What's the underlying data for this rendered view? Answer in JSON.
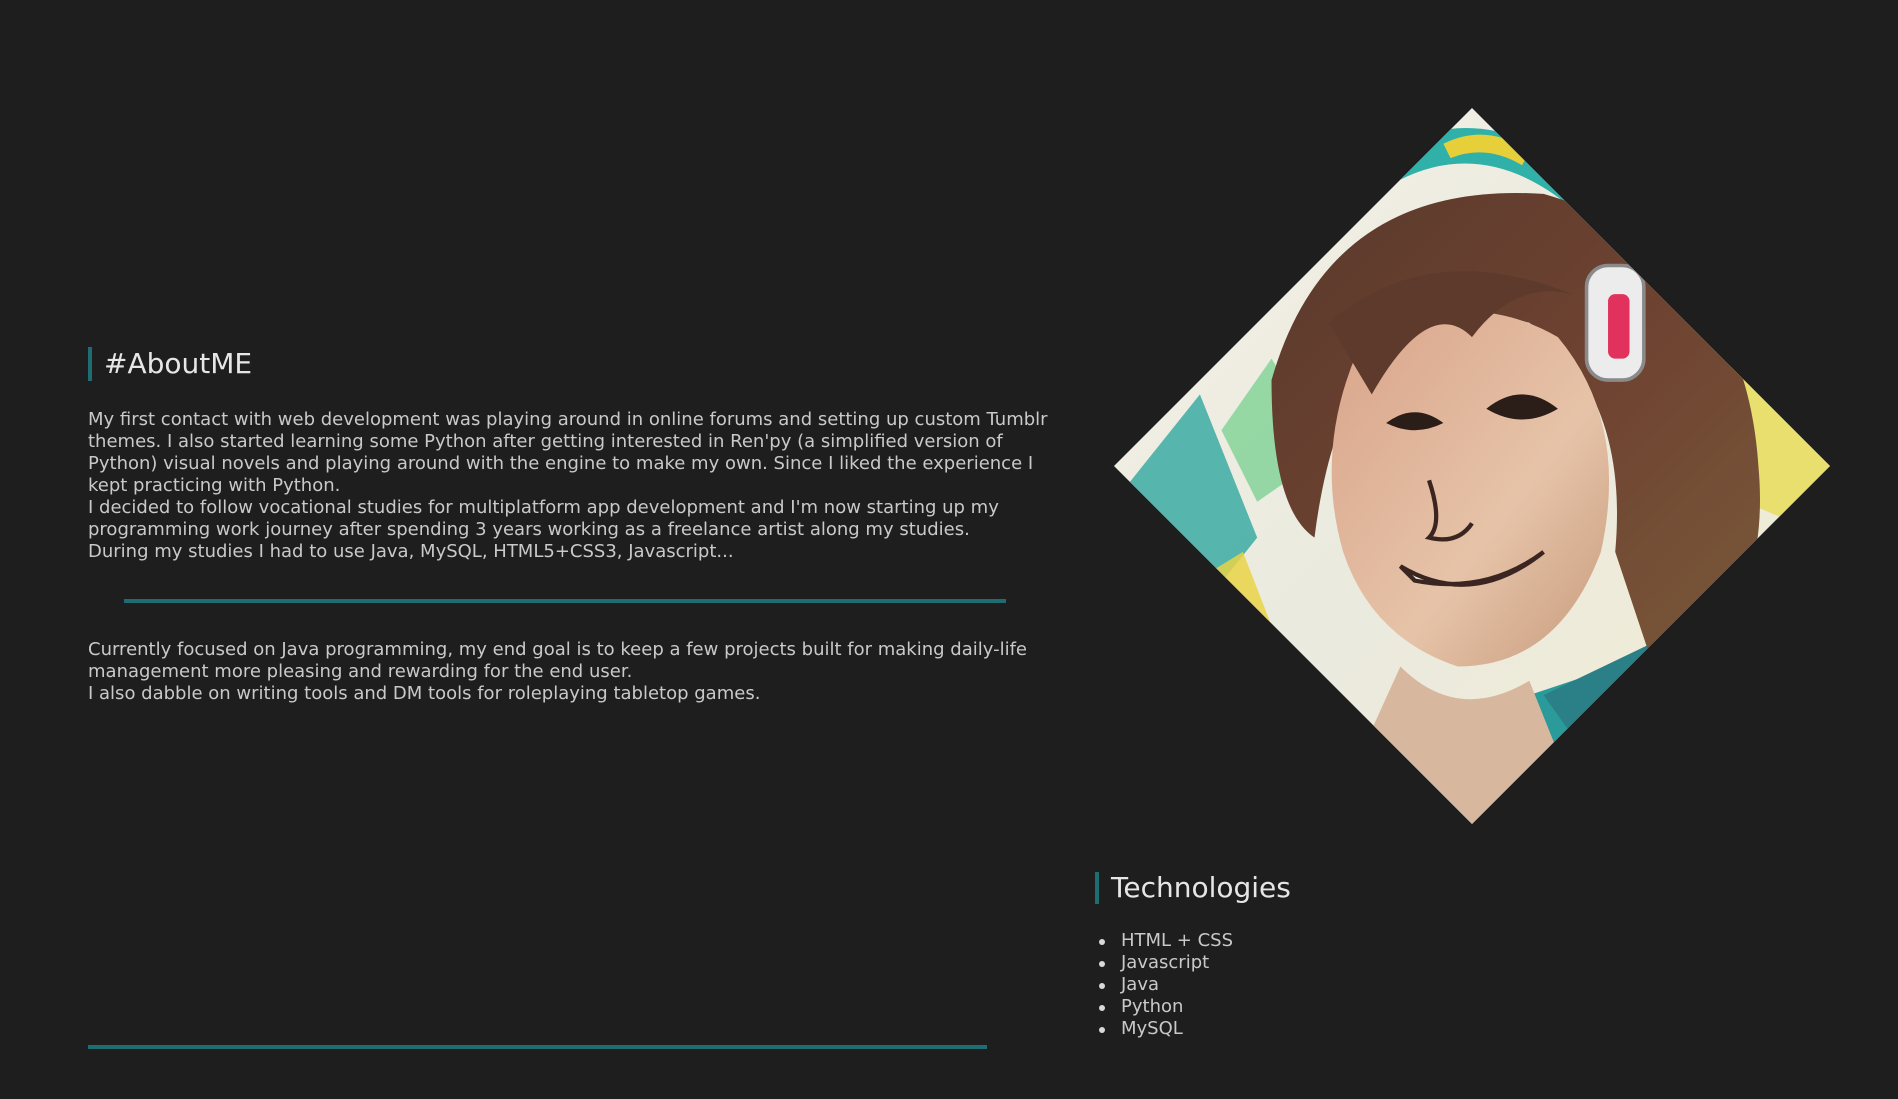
{
  "about": {
    "heading": "#AboutME",
    "paragraph_1": "My first contact with web development was playing around in online forums and setting up custom Tumblr themes. I also started learning some Python after getting interested in Ren'py (a simplified version of Python) visual novels and playing around with the engine to make my own. Since I liked the experience I kept practicing with Python.\nI decided to follow vocational studies for multiplatform app development and I'm now starting up my programming work journey after spending 3 years working as a freelance artist along my studies.\nDuring my studies I had to use Java, MySQL, HTML5+CSS3, Javascript...",
    "paragraph_2": "Currently focused on Java programming, my end goal is to keep a few projects built for making daily-life management more pleasing and rewarding for the end user.\nI also dabble on writing tools and DM tools for roleplaying tabletop games."
  },
  "portrait": {
    "icon": "portrait-illustration"
  },
  "technologies": {
    "heading": "Technologies",
    "items": [
      "HTML + CSS",
      "Javascript",
      "Java",
      "Python",
      "MySQL"
    ]
  },
  "colors": {
    "background": "#1e1e1e",
    "accent": "#1c6e73",
    "text": "#c9c9c9",
    "heading": "#e6e6e6"
  }
}
